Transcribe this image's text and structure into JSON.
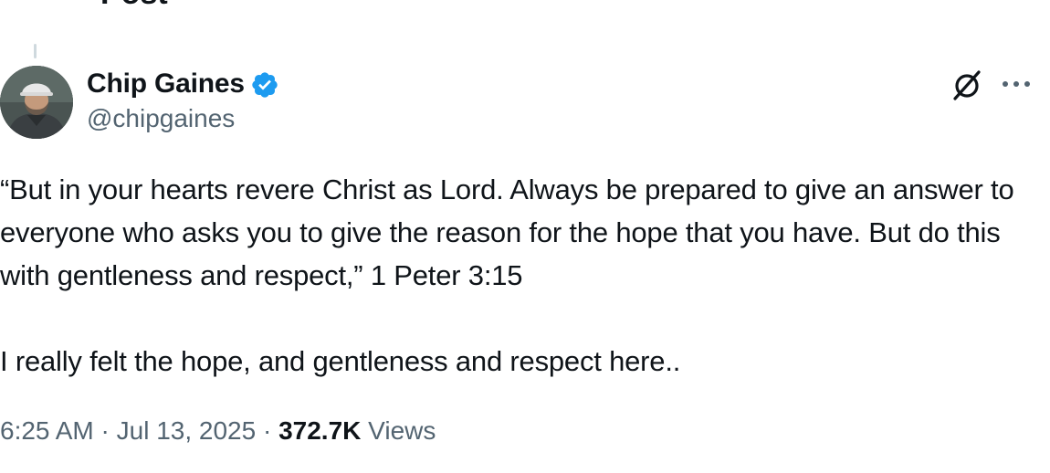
{
  "header": {
    "title": "Post"
  },
  "author": {
    "name": "Chip Gaines",
    "handle": "@chipgaines",
    "verified": true
  },
  "post": {
    "paragraphs": [
      "“But in your hearts revere Christ as Lord. Always be prepared to give an answer to everyone who asks you to give the reason for the hope that you have. But do this with gentleness and respect,” 1 Peter 3:15",
      "I really felt the hope, and gentleness and respect here.."
    ]
  },
  "meta": {
    "time": "6:25 AM",
    "separator": "·",
    "date": "Jul 13, 2025",
    "views_count": "372.7K",
    "views_label": "Views"
  },
  "icons": {
    "back": "arrow-left-icon",
    "grok": "grok-icon",
    "more": "more-horizontal-icon",
    "verified": "verified-badge-icon"
  },
  "colors": {
    "text": "#0f1419",
    "secondary": "#536471",
    "verified": "#1d9bf0"
  }
}
